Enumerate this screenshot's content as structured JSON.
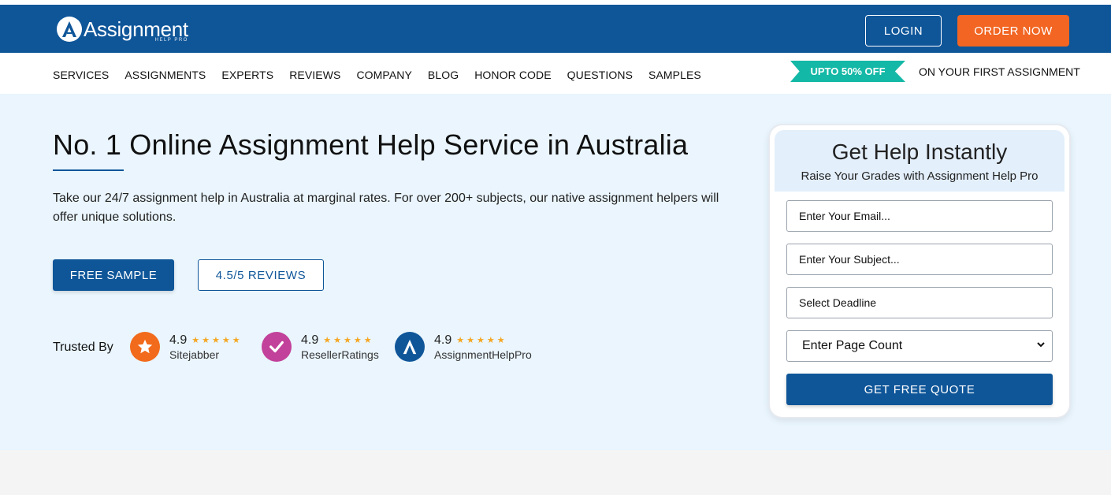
{
  "header": {
    "logo_main": "Assignment",
    "logo_sub": "HELP PRO",
    "login_label": "LOGIN",
    "order_label": "ORDER NOW",
    "accent_color": "#f26522",
    "brand_color": "#0f5699"
  },
  "nav": {
    "items": [
      "SERVICES",
      "ASSIGNMENTS",
      "EXPERTS",
      "REVIEWS",
      "COMPANY",
      "BLOG",
      "HONOR CODE",
      "QUESTIONS",
      "SAMPLES"
    ],
    "promo_badge": "UPTO 50% OFF",
    "promo_text": "ON YOUR FIRST ASSIGNMENT",
    "promo_color": "#14b8a6"
  },
  "hero": {
    "title": "No. 1 Online Assignment Help Service in Australia",
    "description": "Take our 24/7 assignment help in Australia at marginal rates. For over 200+ subjects, our native assignment helpers will offer unique solutions.",
    "free_sample_label": "FREE SAMPLE",
    "reviews_label": "4.5/5 REVIEWS",
    "trusted_label": "Trusted By",
    "trust": [
      {
        "rating": "4.9",
        "stars": "★★★★★",
        "name": "Sitejabber",
        "icon": "sitejabber-star-icon",
        "color": "#f26a1b"
      },
      {
        "rating": "4.9",
        "stars": "★★★★★",
        "name": "ResellerRatings",
        "icon": "resellerratings-check-icon",
        "color": "#c2419a"
      },
      {
        "rating": "4.9",
        "stars": "★★★★★",
        "name": "AssignmentHelpPro",
        "icon": "assignmenthelppro-logo-icon",
        "color": "#0f5699"
      }
    ]
  },
  "form": {
    "title": "Get Help Instantly",
    "subtitle": "Raise Your Grades with Assignment Help Pro",
    "email_placeholder": "Enter Your Email...",
    "subject_placeholder": "Enter Your Subject...",
    "deadline_placeholder": "Select Deadline",
    "page_count_selected": "Enter Page Count",
    "quote_label": "GET FREE QUOTE"
  }
}
